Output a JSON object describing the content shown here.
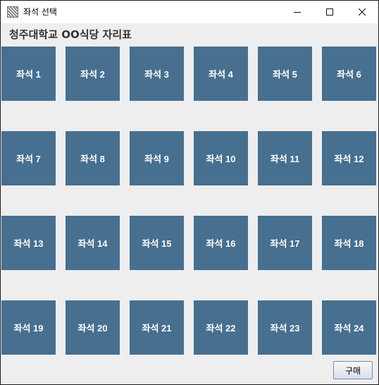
{
  "window": {
    "title": "좌석 선택",
    "icon": "app-icon"
  },
  "page": {
    "title": "청주대학교 OO식당 자리표"
  },
  "seats": [
    "좌석 1",
    "좌석 2",
    "좌석 3",
    "좌석 4",
    "좌석 5",
    "좌석 6",
    "좌석 7",
    "좌석 8",
    "좌석 9",
    "좌석 10",
    "좌석 11",
    "좌석 12",
    "좌석 13",
    "좌석 14",
    "좌석 15",
    "좌석 16",
    "좌석 17",
    "좌석 18",
    "좌석 19",
    "좌석 20",
    "좌석 21",
    "좌석 22",
    "좌석 23",
    "좌석 24"
  ],
  "actions": {
    "buy_label": "구매"
  },
  "colors": {
    "seat": "#466f90",
    "background": "#eeeeee"
  }
}
